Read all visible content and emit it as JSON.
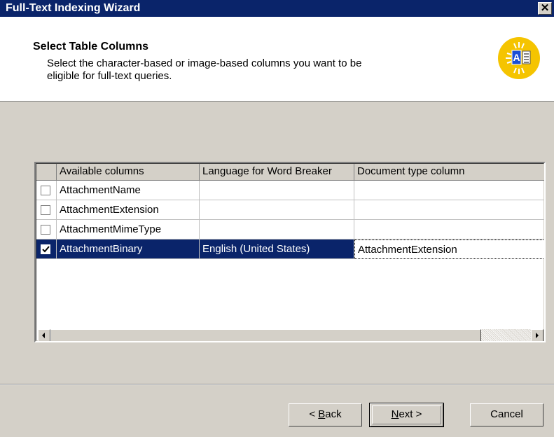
{
  "window": {
    "title": "Full-Text Indexing Wizard",
    "close_glyph": "✕"
  },
  "header": {
    "title": "Select Table Columns",
    "description": "Select the character-based or image-based columns you want to be eligible for full-text queries.",
    "icon": "full-text-index-icon"
  },
  "grid": {
    "columns": [
      "Available columns",
      "Language for Word Breaker",
      "Document type column"
    ],
    "rows": [
      {
        "checked": false,
        "name": "AttachmentName",
        "language": "",
        "doctype": ""
      },
      {
        "checked": false,
        "name": "AttachmentExtension",
        "language": "",
        "doctype": ""
      },
      {
        "checked": false,
        "name": "AttachmentMimeType",
        "language": "",
        "doctype": ""
      },
      {
        "checked": true,
        "name": "AttachmentBinary",
        "language": "English (United States)",
        "doctype": "AttachmentExtension"
      }
    ]
  },
  "buttons": {
    "back": {
      "accel": "B",
      "rest": "ack",
      "prefix": "< ",
      "suffix": ""
    },
    "next": {
      "accel": "N",
      "rest": "ext",
      "prefix": "",
      "suffix": " >"
    },
    "cancel": "Cancel"
  },
  "colors": {
    "titlebar": "#0a246a",
    "dialog": "#d4d0c8",
    "selection": "#0a246a"
  }
}
